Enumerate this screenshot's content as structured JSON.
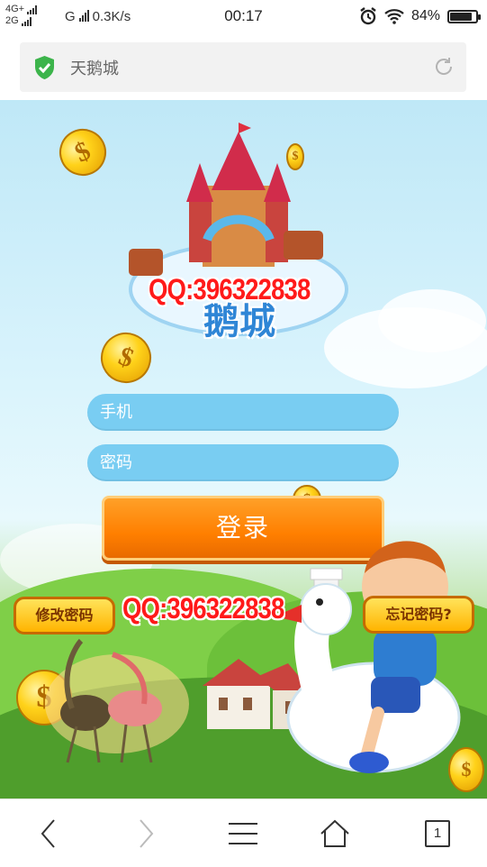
{
  "status_bar": {
    "network_top": "4G+",
    "network_bottom": "2G",
    "network_type": "G",
    "speed": "0.3K/s",
    "time": "00:17",
    "battery_percent": "84%",
    "battery_level": 0.84
  },
  "url_bar": {
    "title": "天鹅城",
    "icons": [
      "shield-check-icon",
      "reload-icon"
    ]
  },
  "game": {
    "logo_text": "鹅城",
    "watermark_top": "QQ:396322838",
    "watermark_mid": "QQ:396322838",
    "phone_placeholder": "手机",
    "password_placeholder": "密码",
    "login_label": "登录",
    "change_password_label": "修改密码",
    "forgot_password_label": "忘记密码?",
    "coin_symbol": "$"
  },
  "nav": {
    "tab_count": "1",
    "icons": [
      "back-icon",
      "forward-icon",
      "menu-icon",
      "home-icon",
      "tabs-icon"
    ]
  },
  "colors": {
    "accent_orange": "#ff8a00",
    "field_blue": "#79cdf2",
    "watermark_red": "#ff1a1a",
    "shield_green": "#3cb44b"
  }
}
